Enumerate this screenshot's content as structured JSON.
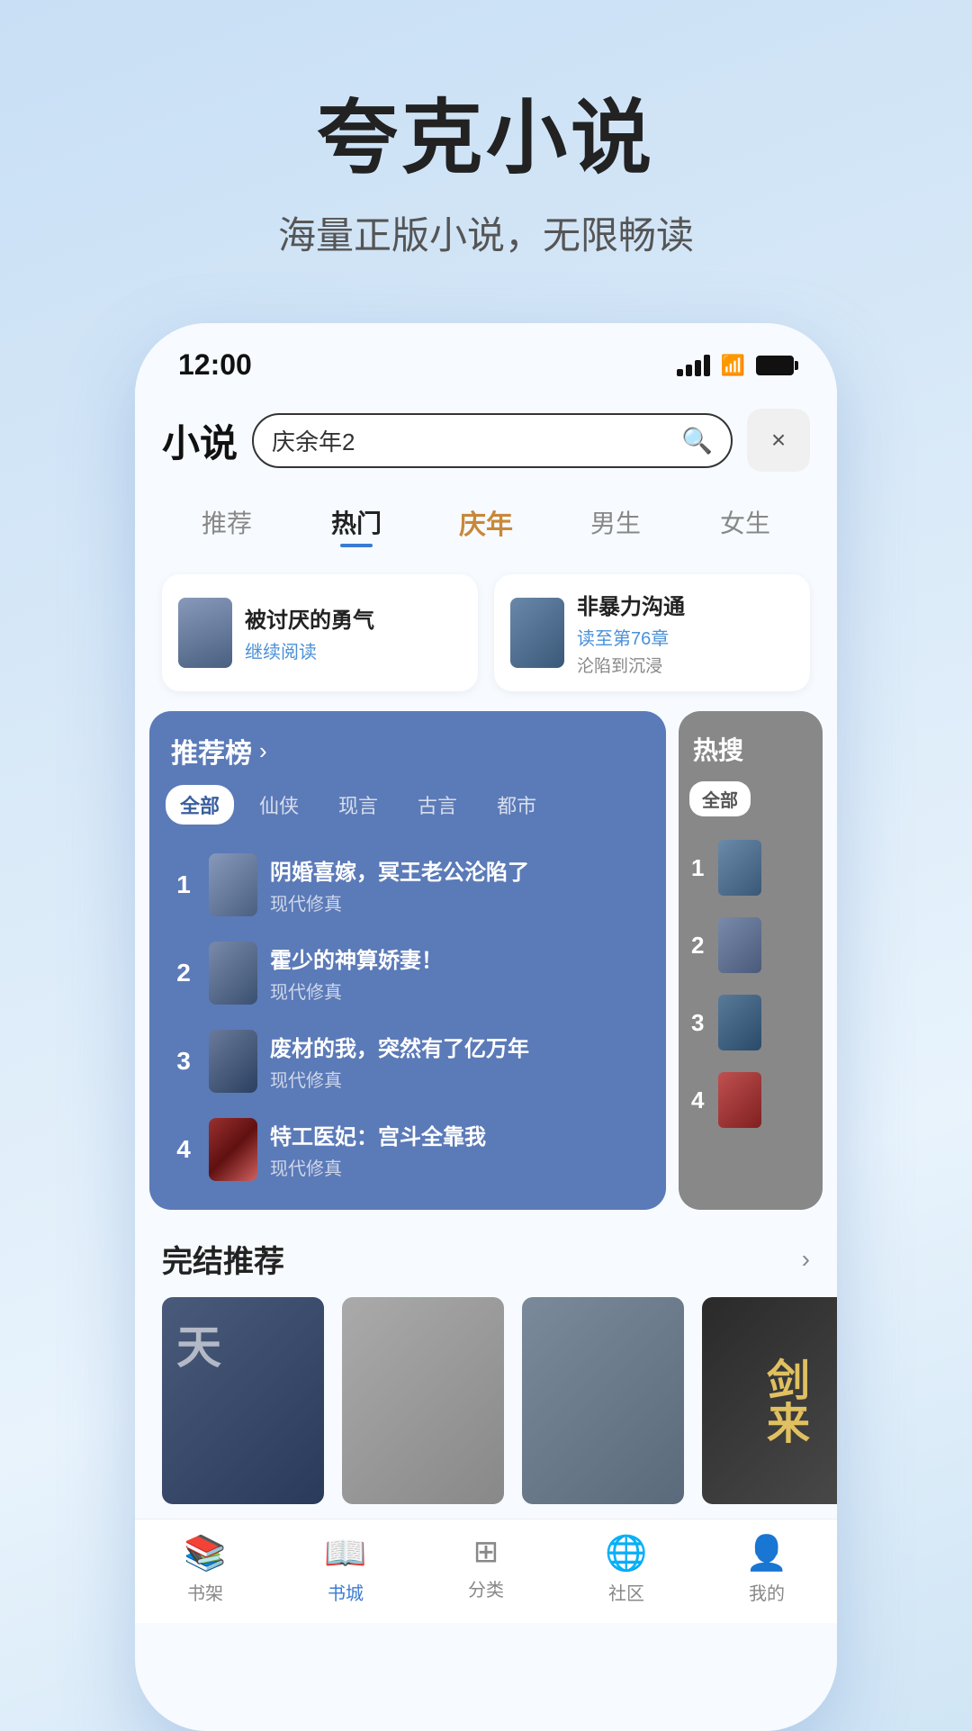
{
  "app": {
    "name": "夸克小说",
    "tagline": "海量正版小说，无限畅读"
  },
  "status_bar": {
    "time": "12:00"
  },
  "header": {
    "title": "小说",
    "search_placeholder": "庆余年2",
    "close_label": "×"
  },
  "nav_tabs": [
    {
      "label": "推荐",
      "active": false,
      "special": false
    },
    {
      "label": "热门",
      "active": true,
      "special": false
    },
    {
      "label": "庆年",
      "active": false,
      "special": true
    },
    {
      "label": "男生",
      "active": false,
      "special": false
    },
    {
      "label": "女生",
      "active": false,
      "special": false
    }
  ],
  "recent_reads": [
    {
      "title": "被讨厌的勇气",
      "action": "继续阅读",
      "cover_color": "#7a8aaa"
    },
    {
      "title": "非暴力沟通",
      "action": "读至第76章",
      "progress": "沦陷到沉浸",
      "cover_color": "#4a6888"
    }
  ],
  "rec_panel": {
    "title": "推荐榜",
    "arrow": "›",
    "filters": [
      "全部",
      "仙侠",
      "现言",
      "古言",
      "都市"
    ],
    "active_filter": "全部",
    "items": [
      {
        "rank": "1",
        "title": "阴婚喜嫁，冥王老公沦陷了",
        "tag": "现代修真"
      },
      {
        "rank": "2",
        "title": "霍少的神算娇妻！",
        "tag": "现代修真"
      },
      {
        "rank": "3",
        "title": "废材的我，突然有了亿万年",
        "tag": "现代修真"
      },
      {
        "rank": "4",
        "title": "特工医妃：宫斗全靠我",
        "tag": "现代修真"
      }
    ]
  },
  "hot_panel": {
    "title": "热搜",
    "filter": "全部",
    "items": [
      {
        "rank": "1"
      },
      {
        "rank": "2"
      },
      {
        "rank": "3"
      },
      {
        "rank": "4"
      }
    ]
  },
  "complete_section": {
    "title": "完结推荐",
    "arrow": "›",
    "books": [
      {
        "title": "天",
        "thumb_style": "thumb-1"
      },
      {
        "title": "",
        "thumb_style": "thumb-2"
      },
      {
        "title": "",
        "thumb_style": "thumb-3"
      },
      {
        "title": "剑来",
        "thumb_style": "thumb-4"
      }
    ]
  },
  "bottom_nav": [
    {
      "label": "书架",
      "icon": "📚",
      "active": false
    },
    {
      "label": "书城",
      "icon": "📖",
      "active": true
    },
    {
      "label": "分类",
      "icon": "⊞",
      "active": false
    },
    {
      "label": "社区",
      "icon": "💬",
      "active": false
    },
    {
      "label": "我的",
      "icon": "👤",
      "active": false
    }
  ]
}
